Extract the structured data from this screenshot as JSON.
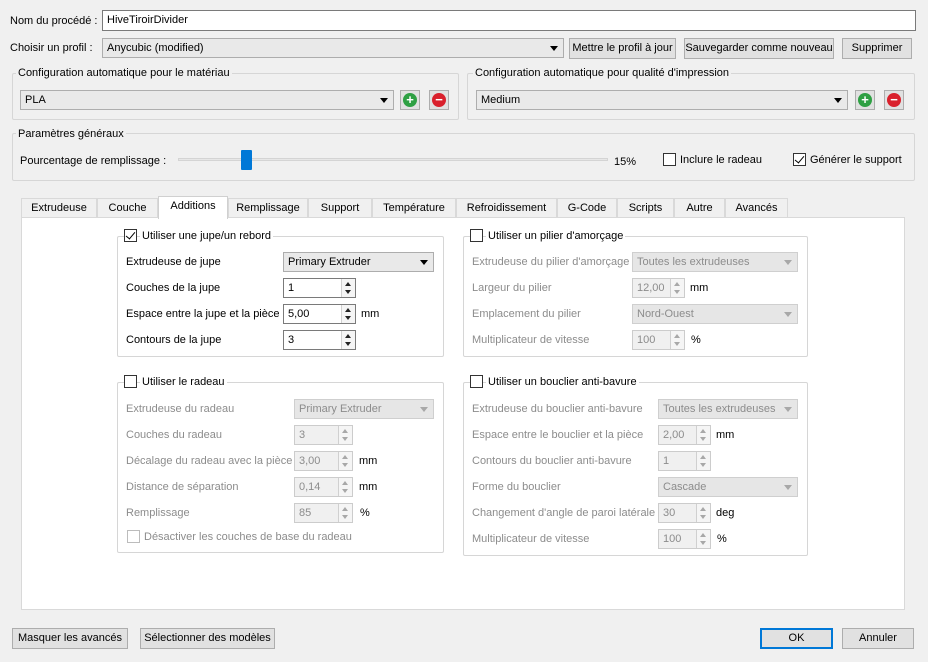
{
  "process_name": {
    "label": "Nom du procédé :",
    "value": "HiveTiroirDivider"
  },
  "profile": {
    "label": "Choisir un profil :",
    "value": "Anycubic (modified)",
    "update_button": "Mettre le profil à jour",
    "save_new_button": "Sauvegarder comme nouveau",
    "delete_button": "Supprimer"
  },
  "material": {
    "title": "Configuration automatique pour le matériau",
    "value": "PLA"
  },
  "quality": {
    "title": "Configuration automatique pour qualité d'impression",
    "value": "Medium"
  },
  "general": {
    "title": "Paramètres généraux",
    "infill_label": "Pourcentage de remplissage :",
    "infill_value": "15%",
    "infill_fraction": 0.15,
    "raft_label": "Inclure le radeau",
    "raft_checked": false,
    "support_label": "Générer le support",
    "support_checked": true
  },
  "tabs": [
    {
      "label": "Extrudeuse"
    },
    {
      "label": "Couche"
    },
    {
      "label": "Additions",
      "active": true
    },
    {
      "label": "Remplissage"
    },
    {
      "label": "Support"
    },
    {
      "label": "Température"
    },
    {
      "label": "Refroidissement"
    },
    {
      "label": "G-Code"
    },
    {
      "label": "Scripts"
    },
    {
      "label": "Autre"
    },
    {
      "label": "Avancés"
    }
  ],
  "skirt": {
    "title": "Utiliser une jupe/un rebord",
    "checked": true,
    "extruder_label": "Extrudeuse de jupe",
    "extruder_value": "Primary Extruder",
    "layers_label": "Couches de la jupe",
    "layers_value": "1",
    "offset_label": "Espace entre la jupe et la pièce",
    "offset_value": "5,00",
    "offset_unit": "mm",
    "outlines_label": "Contours de la jupe",
    "outlines_value": "3"
  },
  "prime_pillar": {
    "title": "Utiliser un pilier d'amorçage",
    "checked": false,
    "extruder_label": "Extrudeuse du pilier d'amorçage",
    "extruder_value": "Toutes les extrudeuses",
    "width_label": "Largeur du pilier",
    "width_value": "12,00",
    "width_unit": "mm",
    "location_label": "Emplacement du pilier",
    "location_value": "Nord-Ouest",
    "speed_label": "Multiplicateur de vitesse",
    "speed_value": "100",
    "speed_unit": "%"
  },
  "raft": {
    "title": "Utiliser le radeau",
    "checked": false,
    "extruder_label": "Extrudeuse du radeau",
    "extruder_value": "Primary Extruder",
    "layers_label": "Couches du radeau",
    "layers_value": "3",
    "offset_label": "Décalage du radeau avec la pièce",
    "offset_value": "3,00",
    "offset_unit": "mm",
    "separation_label": "Distance de séparation",
    "separation_value": "0,14",
    "separation_unit": "mm",
    "infill_label": "Remplissage",
    "infill_value": "85",
    "infill_unit": "%",
    "disable_base_label": "Désactiver les couches de base du radeau"
  },
  "ooze_shield": {
    "title": "Utiliser un bouclier anti-bavure",
    "checked": false,
    "extruder_label": "Extrudeuse du bouclier anti-bavure",
    "extruder_value": "Toutes les extrudeuses",
    "offset_label": "Espace entre le bouclier et la pièce",
    "offset_value": "2,00",
    "offset_unit": "mm",
    "outlines_label": "Contours du bouclier anti-bavure",
    "outlines_value": "1",
    "shape_label": "Forme du bouclier",
    "shape_value": "Cascade",
    "angle_label": "Changement d'angle de paroi latérale",
    "angle_value": "30",
    "angle_unit": "deg",
    "speed_label": "Multiplicateur de vitesse",
    "speed_value": "100",
    "speed_unit": "%"
  },
  "footer": {
    "hide_advanced_button": "Masquer les avancés",
    "select_models_button": "Sélectionner des modèles",
    "ok_button": "OK",
    "cancel_button": "Annuler"
  }
}
